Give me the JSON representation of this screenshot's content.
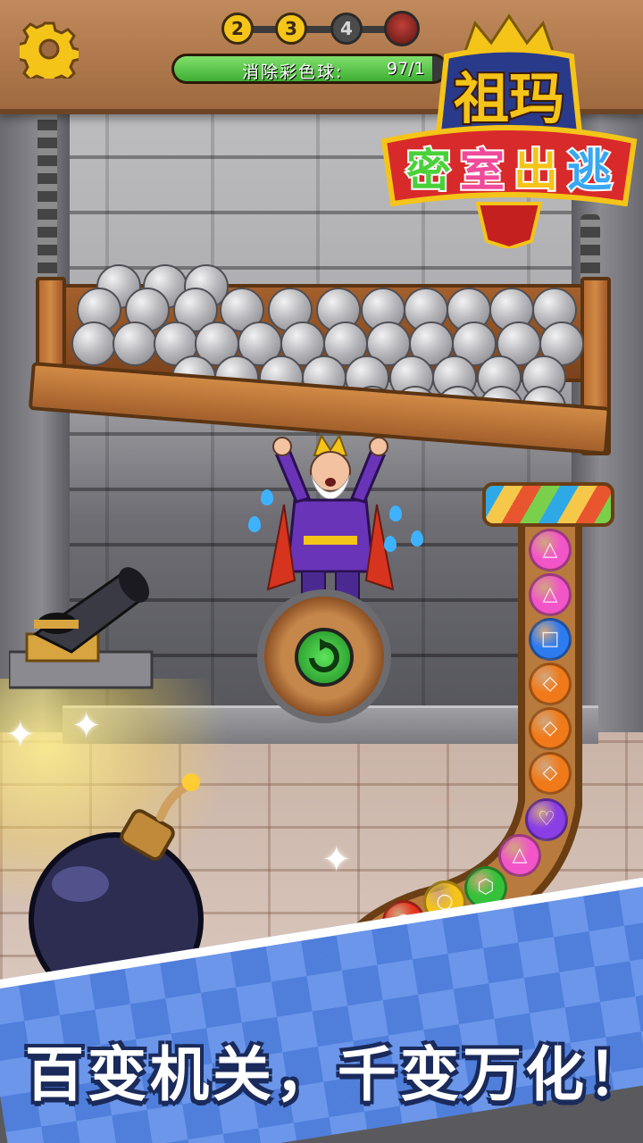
{
  "header": {
    "stages": [
      {
        "label": "2",
        "state": "done"
      },
      {
        "label": "3",
        "state": "done"
      },
      {
        "label": "4",
        "state": "next"
      }
    ],
    "objective_label": "消除彩色球:",
    "objective_value": "97/1",
    "objective_progress": 0.95
  },
  "logo": {
    "line1": "祖玛",
    "line2_chars": [
      "密",
      "室",
      "出",
      "逃"
    ],
    "line2_colors": [
      "#4ad13a",
      "#f04a9a",
      "#f4c419",
      "#3aa7f0"
    ]
  },
  "tube_balls": [
    {
      "color": "#f255c8",
      "symbol": "△"
    },
    {
      "color": "#f255c8",
      "symbol": "△"
    },
    {
      "color": "#2e7bf0",
      "symbol": "□"
    },
    {
      "color": "#f07a1a",
      "symbol": "◇"
    },
    {
      "color": "#f07a1a",
      "symbol": "◇"
    },
    {
      "color": "#f07a1a",
      "symbol": "◇"
    },
    {
      "color": "#8a3ee6",
      "symbol": "♡"
    },
    {
      "color": "#f255c8",
      "symbol": "△"
    },
    {
      "color": "#35c23a",
      "symbol": "⬡"
    },
    {
      "color": "#f4c419",
      "symbol": "○"
    },
    {
      "color": "#e8321e",
      "symbol": "○"
    },
    {
      "color": "#f07a1a",
      "symbol": "◇"
    },
    {
      "color": "#d8402a",
      "symbol": "△"
    }
  ],
  "banner": {
    "slogan": "百变机关，千变万化！"
  },
  "colors": {
    "topbar": "#b07a4e",
    "accent_gold": "#f4c419",
    "banner_blue": "#6b96ea"
  },
  "icons": [
    "settings-gear-icon",
    "boss-portrait-icon",
    "bomb-icon",
    "cannon-icon",
    "crown-icon"
  ]
}
